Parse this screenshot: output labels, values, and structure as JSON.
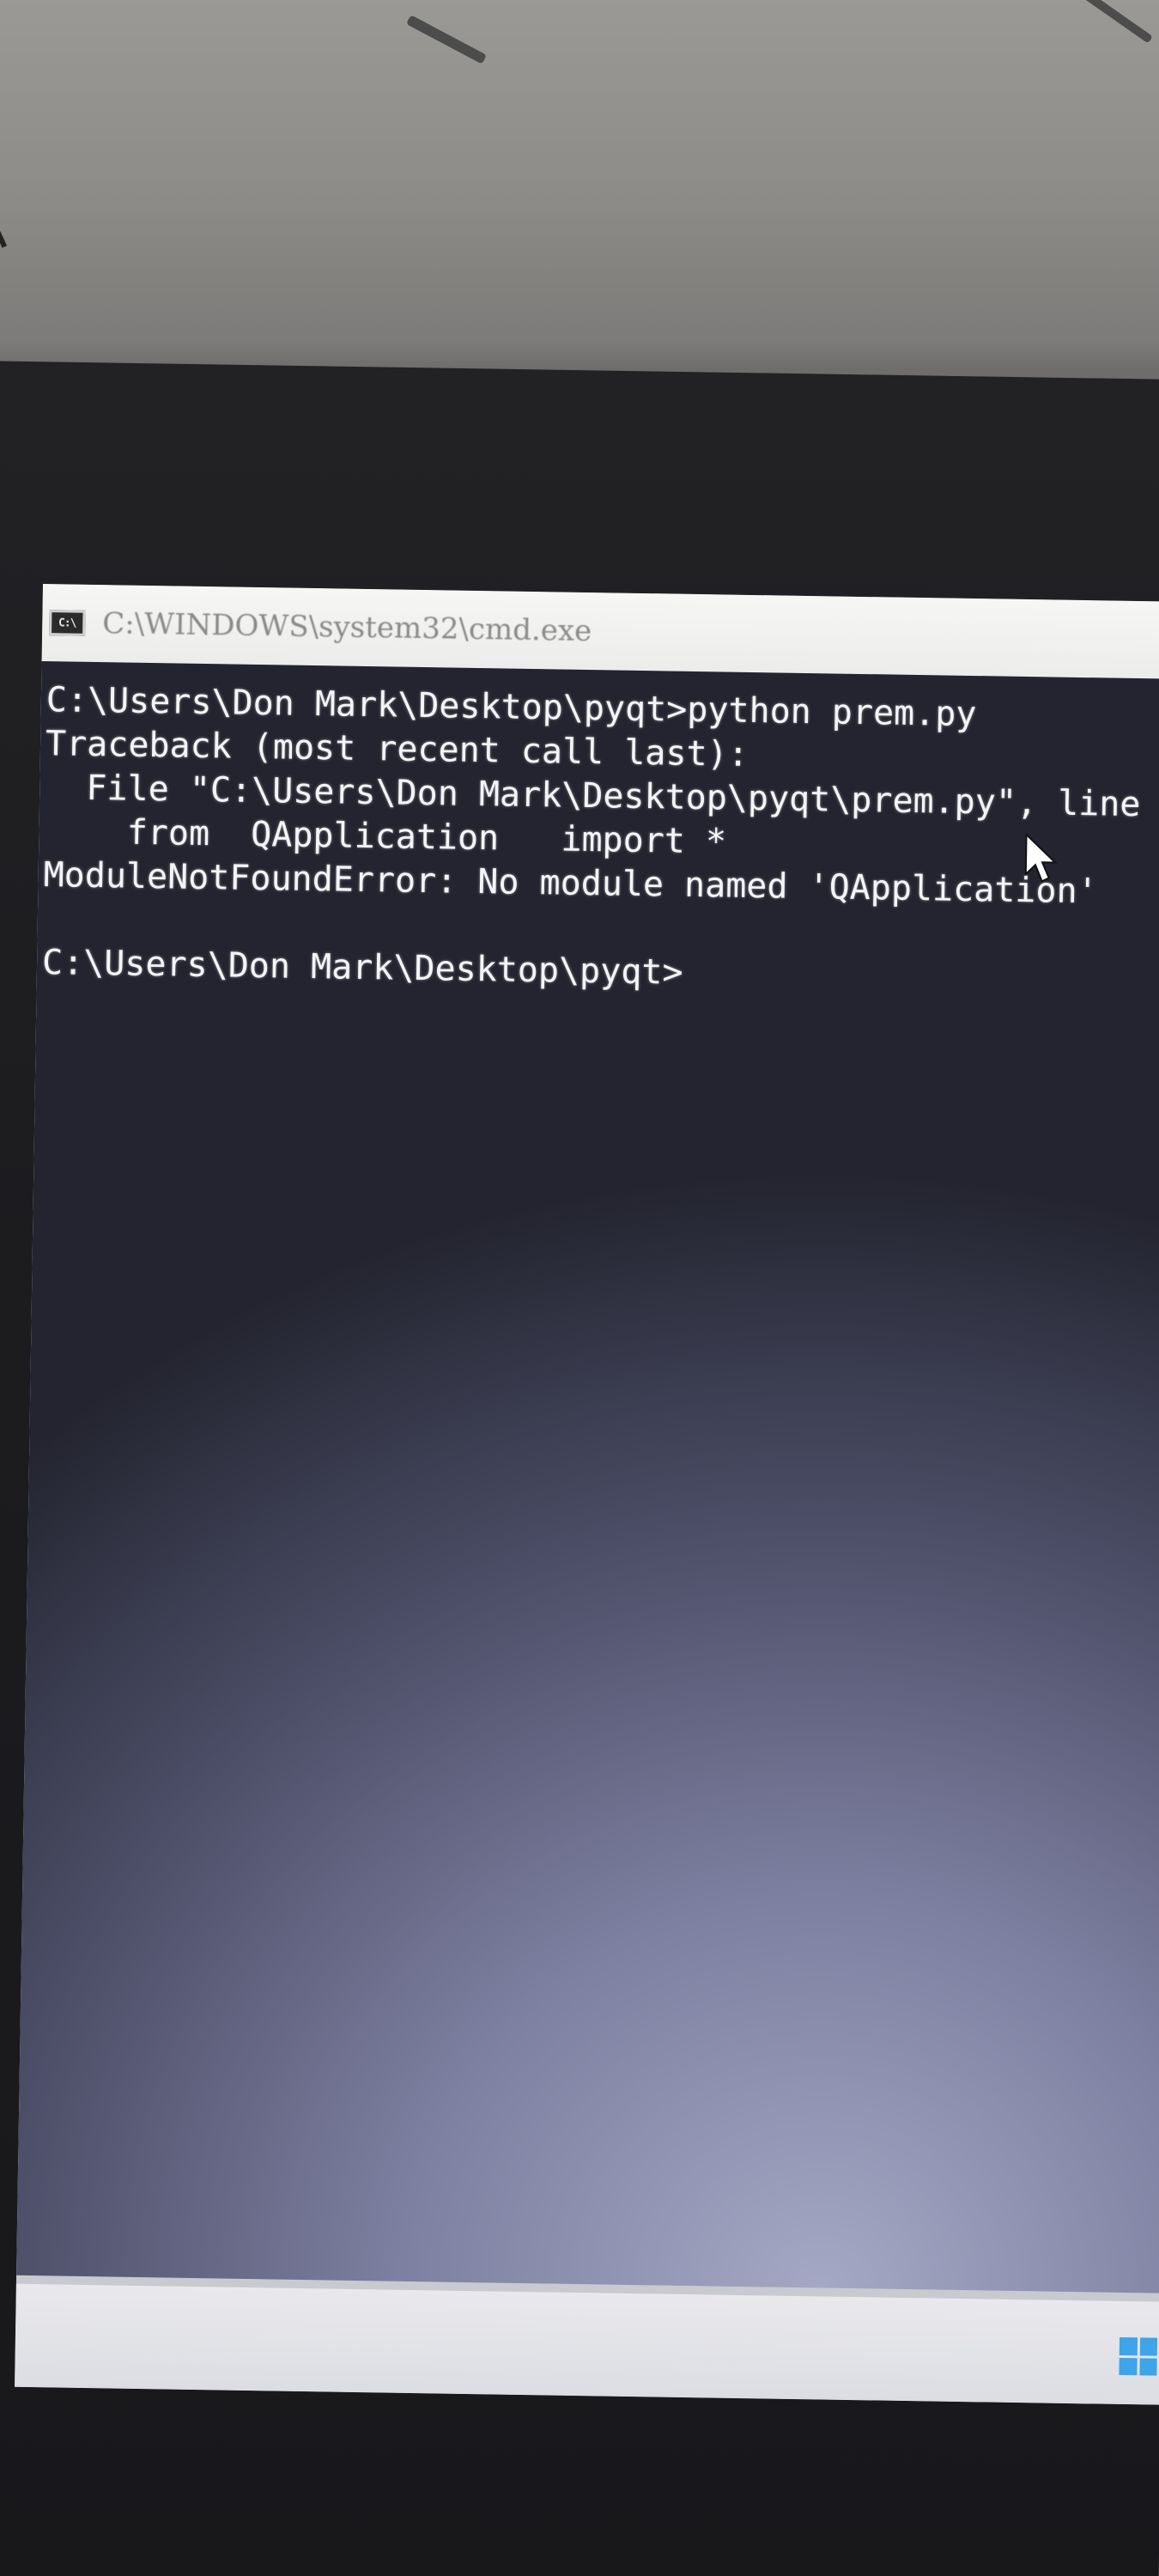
{
  "window": {
    "title": "C:\\WINDOWS\\system32\\cmd.exe",
    "icon": "cmd-icon"
  },
  "console": {
    "lines": [
      "C:\\Users\\Don Mark\\Desktop\\pyqt>python prem.py",
      "Traceback (most recent call last):",
      "  File \"C:\\Users\\Don Mark\\Desktop\\pyqt\\prem.py\", line",
      "    from  QApplication   import *",
      "ModuleNotFoundError: No module named 'QApplication'",
      "",
      "C:\\Users\\Don Mark\\Desktop\\pyqt>"
    ]
  },
  "taskbar": {
    "start_icon": "windows-logo-icon",
    "accent": "#3ea5e8"
  }
}
